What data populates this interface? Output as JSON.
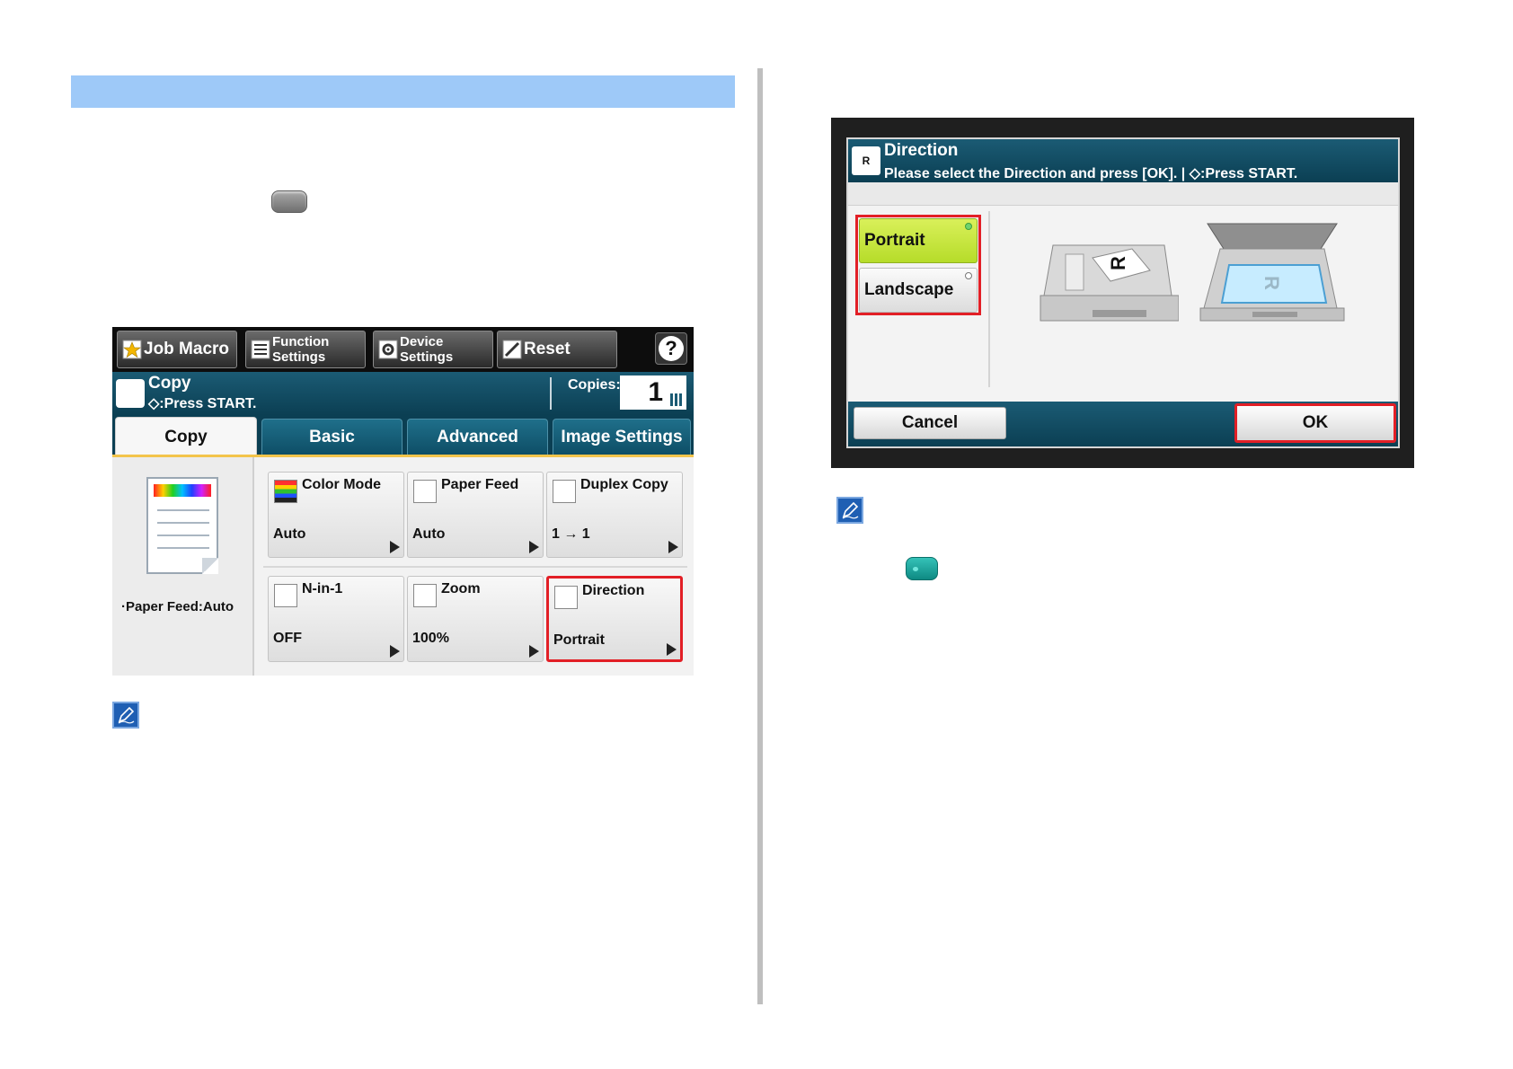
{
  "copy_screen": {
    "topbar": {
      "job_macro": "Job Macro",
      "function_settings": "Function\nSettings",
      "device_settings": "Device\nSettings",
      "reset": "Reset",
      "help": "?"
    },
    "status": {
      "title": "Copy",
      "subtitle": "◇:Press START.",
      "copies_label": "Copies:",
      "copies_value": "1"
    },
    "tabs": [
      "Copy",
      "Basic",
      "Advanced",
      "Image Settings"
    ],
    "preview": {
      "paper_feed": "·Paper Feed:Auto"
    },
    "functions": [
      {
        "name": "Color Mode",
        "value": "Auto",
        "icon": "color-mode-icon"
      },
      {
        "name": "Paper Feed",
        "value": "Auto",
        "icon": "paper-feed-icon"
      },
      {
        "name": "Duplex Copy",
        "value": "1 → 1",
        "icon": "duplex-copy-icon"
      },
      {
        "name": "N-in-1",
        "value": "OFF",
        "icon": "n-in-1-icon"
      },
      {
        "name": "Zoom",
        "value": "100%",
        "icon": "zoom-icon"
      },
      {
        "name": "Direction",
        "value": "Portrait",
        "icon": "direction-icon"
      }
    ]
  },
  "direction_screen": {
    "title": "Direction",
    "subtitle": "Please select the Direction and press [OK]. | ◇:Press START.",
    "options": [
      "Portrait",
      "Landscape"
    ],
    "cancel": "Cancel",
    "ok": "OK"
  },
  "colors": {
    "header_bar": "#9ec9f8",
    "highlight": "#e21f26",
    "panel_blue": "#0b3f53",
    "selected_option": "#c8e63c"
  }
}
